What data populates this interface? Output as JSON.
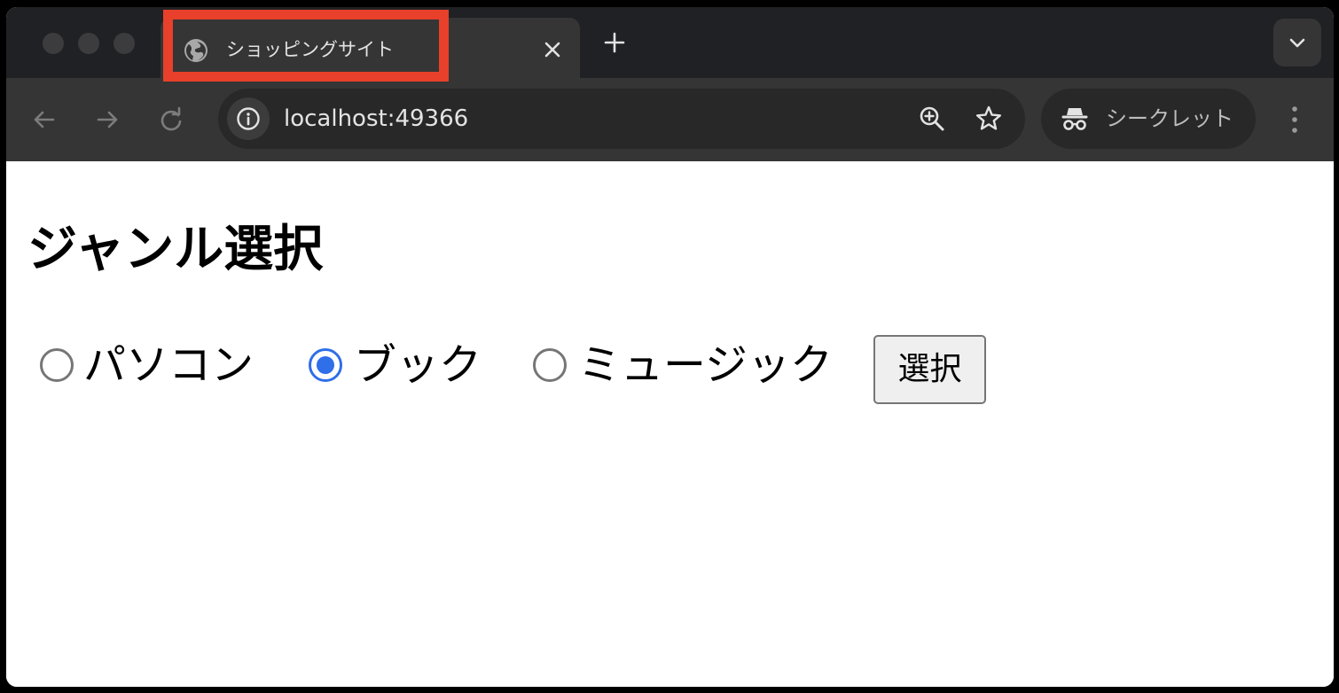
{
  "browser": {
    "tab": {
      "title": "ショッピングサイト",
      "icon": "globe-icon"
    },
    "address_bar": {
      "url": "localhost:49366"
    },
    "profile": {
      "label": "シークレット",
      "icon": "incognito-icon"
    }
  },
  "page": {
    "heading": "ジャンル選択",
    "genres": [
      {
        "label": "パソコン",
        "checked": false
      },
      {
        "label": "ブック",
        "checked": true
      },
      {
        "label": "ミュージック",
        "checked": false
      }
    ],
    "submit_label": "選択"
  },
  "colors": {
    "highlight": "#e8402a",
    "radio_accent": "#2f6fe8",
    "toolbar": "#353535",
    "tabstrip": "#202124"
  }
}
